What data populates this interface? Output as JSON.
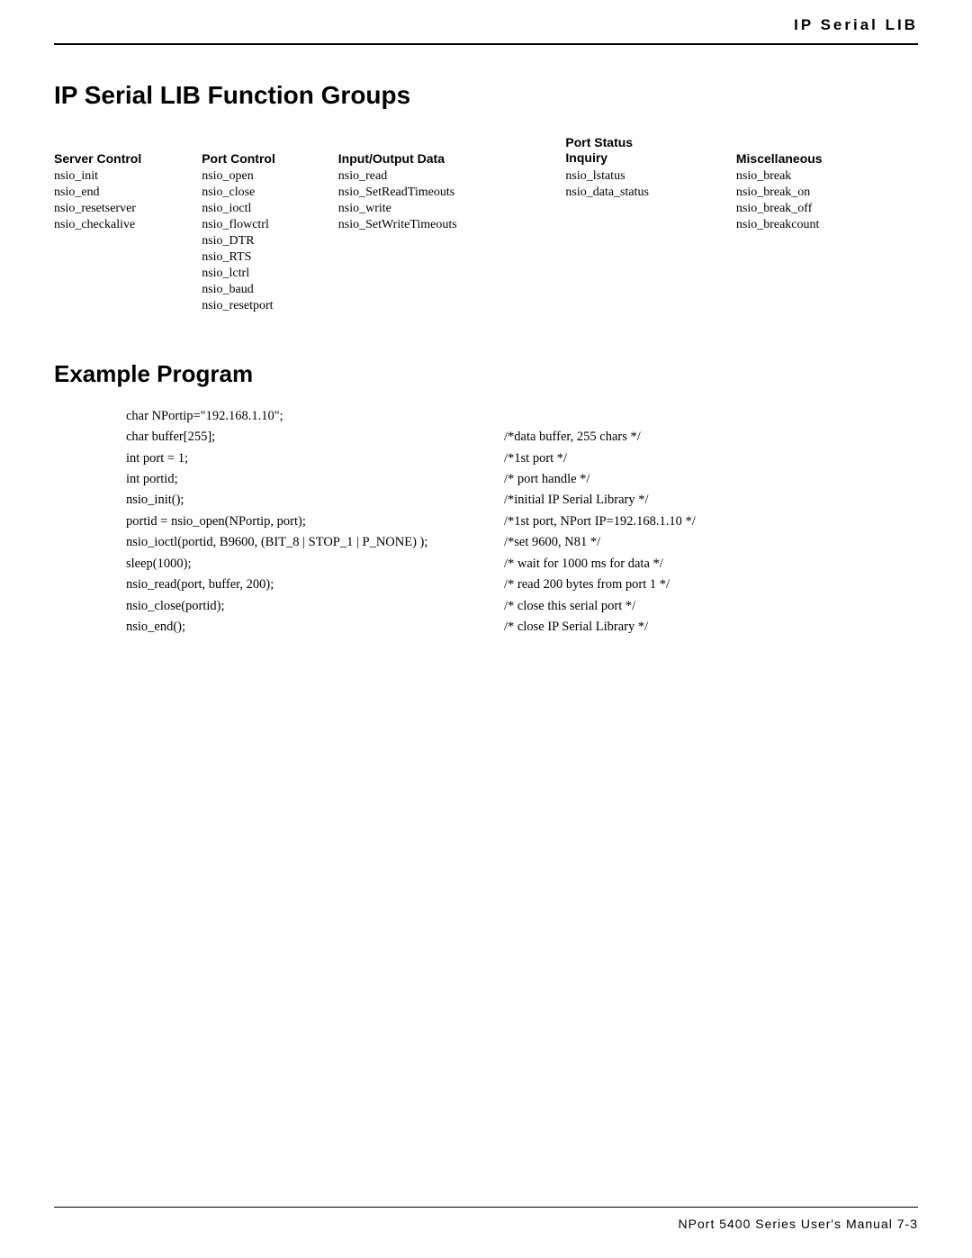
{
  "header": {
    "title": "IP  Serial  LIB"
  },
  "main_heading": "IP Serial LIB Function Groups",
  "function_groups": {
    "columns": [
      {
        "id": "server",
        "label": "Server Control"
      },
      {
        "id": "port",
        "label": "Port Control"
      },
      {
        "id": "io",
        "label": "Input/Output Data"
      },
      {
        "id": "status",
        "label": "Port Status\nInquiry"
      },
      {
        "id": "misc",
        "label": "Miscellaneous"
      }
    ],
    "rows": [
      [
        "nsio_init",
        "nsio_open",
        "nsio_read",
        "nsio_lstatus",
        "nsio_break"
      ],
      [
        "nsio_end",
        "nsio_close",
        "nsio_SetReadTimeouts",
        "nsio_data_status",
        "nsio_break_on"
      ],
      [
        "nsio_resetserver",
        "nsio_ioctl",
        "nsio_write",
        "",
        "nsio_break_off"
      ],
      [
        "nsio_checkalive",
        "nsio_flowctrl",
        "nsio_SetWriteTimeouts",
        "",
        "nsio_breakcount"
      ],
      [
        "",
        "nsio_DTR",
        "",
        "",
        ""
      ],
      [
        "",
        "nsio_RTS",
        "",
        "",
        ""
      ],
      [
        "",
        "nsio_lctrl",
        "",
        "",
        ""
      ],
      [
        "",
        "nsio_baud",
        "",
        "",
        ""
      ],
      [
        "",
        "nsio_resetport",
        "",
        "",
        ""
      ]
    ]
  },
  "example_program": {
    "heading": "Example Program",
    "lines": [
      {
        "left": "char NPortip=\"192.168.1.10\";",
        "right": ""
      },
      {
        "left": "char buffer[255];",
        "right": "/*data buffer, 255 chars */"
      },
      {
        "left": "int port = 1;",
        "right": "/*1st port */"
      },
      {
        "left": "int portid;",
        "right": "/* port handle */"
      },
      {
        "left": "nsio_init();",
        "right": "/*initial IP Serial Library */"
      },
      {
        "left": "portid = nsio_open(NPortip, port);",
        "right": "/*1st port, NPort IP=192.168.1.10 */"
      },
      {
        "left": "nsio_ioctl(portid, B9600, (BIT_8 | STOP_1 | P_NONE) );",
        "right": "/*set 9600, N81 */"
      },
      {
        "left": "sleep(1000);",
        "right": "/* wait for 1000 ms for data */"
      },
      {
        "left": "nsio_read(port, buffer, 200);",
        "right": "/* read 200 bytes from port 1 */"
      },
      {
        "left": "nsio_close(portid);",
        "right": "/* close this serial port */"
      },
      {
        "left": "nsio_end();",
        "right": "/* close IP Serial Library */"
      }
    ]
  },
  "footer": {
    "text": "NPort  5400  Series  User's Manual   7-3"
  }
}
